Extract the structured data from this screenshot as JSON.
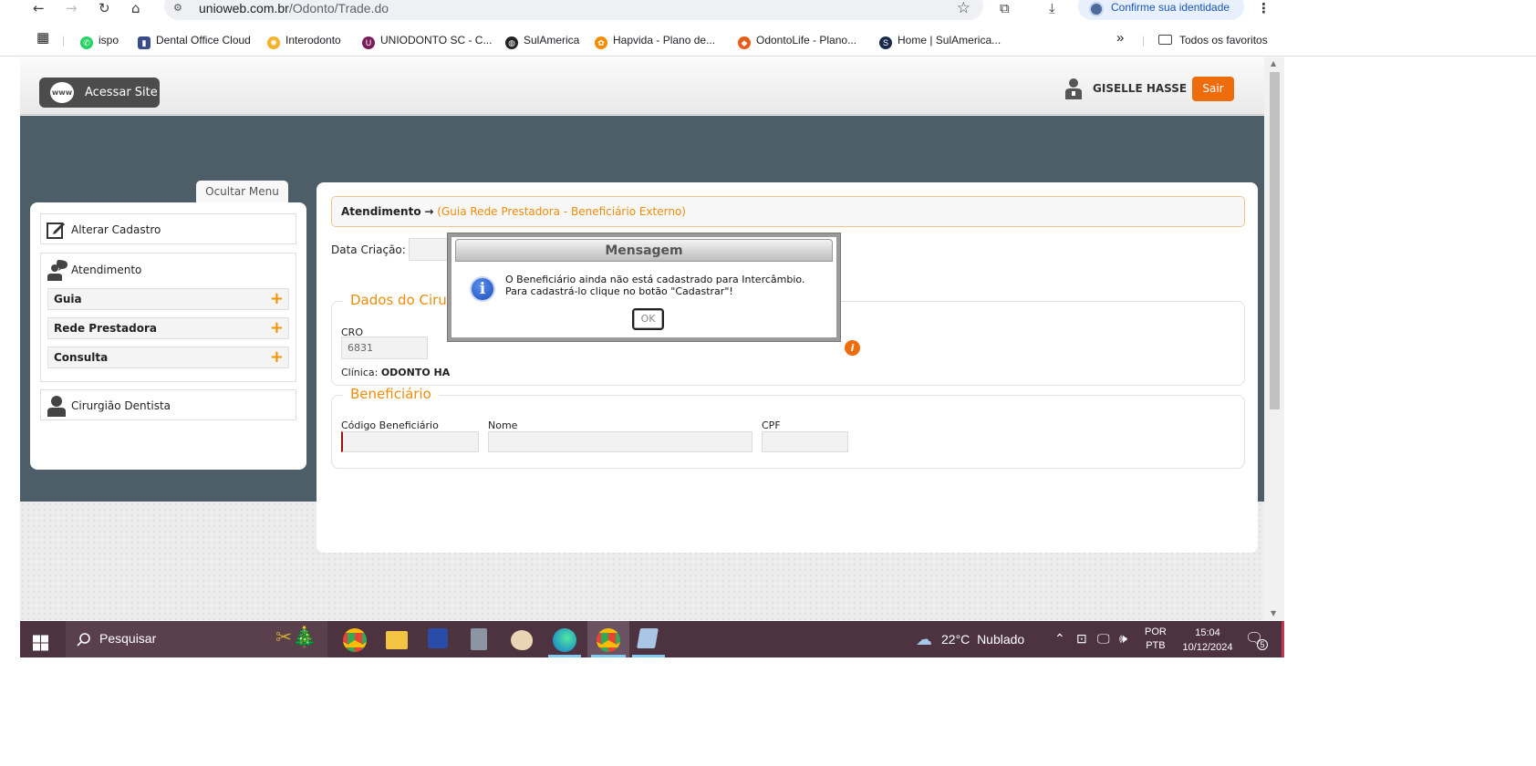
{
  "browser": {
    "url_host": "unioweb.com.br",
    "url_path": "/Odonto/Trade.do",
    "profile_label": "Confirme sua identidade"
  },
  "bookmarks": [
    {
      "label": "ispo",
      "color": "#25d366"
    },
    {
      "label": "Dental Office Cloud",
      "color": "#3a4a8a"
    },
    {
      "label": "Interodonto",
      "color": "#f2b32b"
    },
    {
      "label": "UNIODONTO SC - C...",
      "color": "#7a1e5a"
    },
    {
      "label": "SulAmerica",
      "color": "#222222"
    },
    {
      "label": "Hapvida - Plano de...",
      "color": "#f28c00"
    },
    {
      "label": "OdontoLife - Plano...",
      "color": "#e85c1a"
    },
    {
      "label": "Home | SulAmerica...",
      "color": "#1a2a4a"
    }
  ],
  "bookmarks_overflow": "»",
  "bookmarks_folder": "Todos os favoritos",
  "site": {
    "acessar_label": "Acessar Site",
    "www_label": "www",
    "user_name": "GISELLE HASSE",
    "logout_label": "Sair"
  },
  "sidebar": {
    "hide_menu_label": "Ocultar Menu",
    "alterar_cadastro": "Alterar Cadastro",
    "atendimento": "Atendimento",
    "subitems": [
      {
        "label": "Guia",
        "icon": "+"
      },
      {
        "label": "Rede Prestadora",
        "icon": "+"
      },
      {
        "label": "Consulta",
        "icon": "+"
      }
    ],
    "cirurgiao_dentista": "Cirurgião Dentista"
  },
  "content": {
    "breadcrumb_main": "Atendimento",
    "breadcrumb_arrow": "→",
    "breadcrumb_sub": "(Guia Rede Prestadora - Beneficiário Externo)",
    "data_criacao_label": "Data Criação:",
    "dados_legend": "Dados do Cirurgião",
    "cro_label": "CRO",
    "cro_value": "6831",
    "clinica_label": "Clínica:",
    "clinica_value": "ODONTO HA",
    "beneficiario_legend": "Beneficiário",
    "codigo_label": "Código Beneficiário",
    "nome_label": "Nome",
    "cpf_label": "CPF"
  },
  "modal": {
    "title": "Mensagem",
    "line1": "O Beneficiário ainda não está cadastrado para Intercâmbio.",
    "line2": "Para cadastrá-lo clique no botão \"Cadastrar\"!",
    "ok_label": "OK"
  },
  "taskbar": {
    "search_label": "Pesquisar",
    "temperature": "22°C",
    "weather": "Nublado",
    "lang1": "POR",
    "lang2": "PTB",
    "time": "15:04",
    "date": "10/12/2024",
    "notification_count": "5"
  }
}
